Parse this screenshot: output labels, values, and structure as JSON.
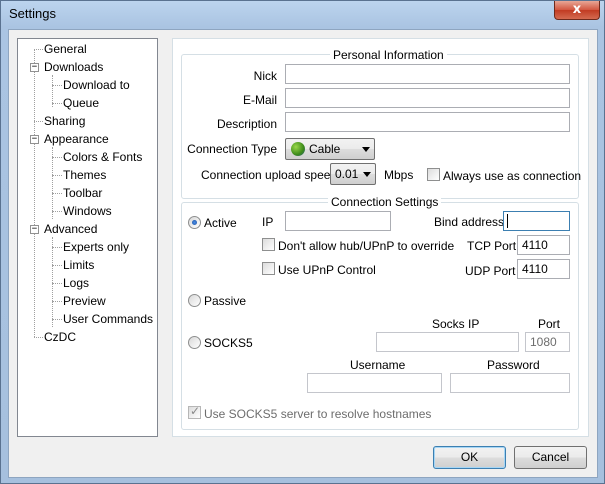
{
  "window": {
    "title": "Settings",
    "close_glyph": "x"
  },
  "tree": {
    "items": [
      {
        "label": "General"
      },
      {
        "label": "Downloads",
        "expander": "−"
      },
      {
        "label": "Download to"
      },
      {
        "label": "Queue"
      },
      {
        "label": "Sharing"
      },
      {
        "label": "Appearance",
        "expander": "−"
      },
      {
        "label": "Colors & Fonts"
      },
      {
        "label": "Themes"
      },
      {
        "label": "Toolbar"
      },
      {
        "label": "Windows"
      },
      {
        "label": "Advanced",
        "expander": "−"
      },
      {
        "label": "Experts only"
      },
      {
        "label": "Limits"
      },
      {
        "label": "Logs"
      },
      {
        "label": "Preview"
      },
      {
        "label": "User Commands"
      },
      {
        "label": "CzDC"
      }
    ]
  },
  "personal": {
    "title": "Personal Information",
    "nick_label": "Nick",
    "nick_value": "",
    "email_label": "E-Mail",
    "email_value": "",
    "description_label": "Description",
    "description_value": "",
    "conn_type_label": "Connection Type",
    "conn_type_value": "Cable",
    "upload_label": "Connection upload speed",
    "upload_value": "0.01",
    "upload_unit": "Mbps",
    "always_use_label": "Always use as connection",
    "always_use_checked": false
  },
  "connection": {
    "title": "Connection Settings",
    "active_label": "Active",
    "active_selected": true,
    "ip_label": "IP",
    "ip_value": "",
    "bind_label": "Bind address",
    "bind_value": "",
    "dont_allow_label": "Don't allow hub/UPnP to override",
    "upnp_label": "Use UPnP Control",
    "tcp_label": "TCP Port",
    "tcp_value": "4110",
    "udp_label": "UDP Port",
    "udp_value": "4110",
    "passive_label": "Passive",
    "socks5_label": "SOCKS5",
    "socks_ip_label": "Socks IP",
    "socks_ip_value": "",
    "port_label": "Port",
    "port_value": "1080",
    "username_label": "Username",
    "username_value": "",
    "password_label": "Password",
    "password_value": "",
    "resolve_label": "Use SOCKS5 server to resolve hostnames",
    "resolve_checked": true
  },
  "buttons": {
    "ok": "OK",
    "cancel": "Cancel"
  },
  "icons": {
    "close": "close-icon",
    "connection_type": "cable-icon"
  },
  "colors": {
    "accent": "#3c7fb1",
    "title_bar": "#aac4e2",
    "close": "#c13b22"
  }
}
